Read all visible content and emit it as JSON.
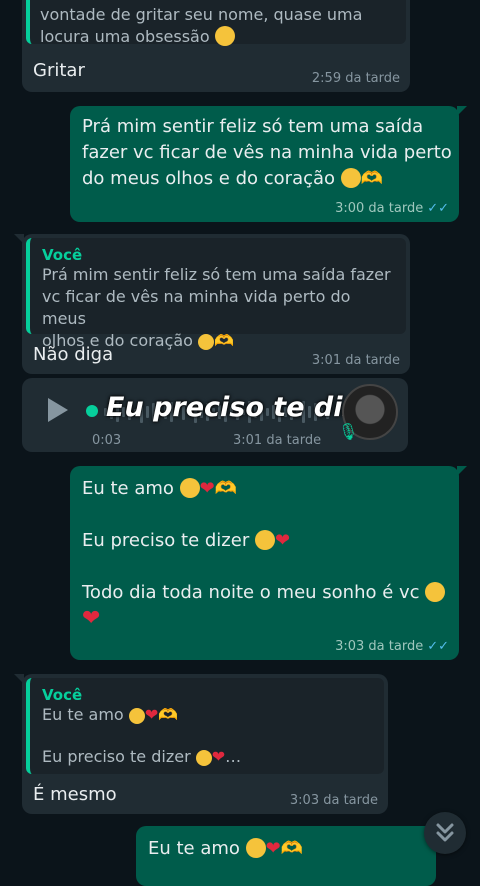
{
  "messages": {
    "m1": {
      "quote_text": "vontade de gritar seu nome, quase uma locura uma obsessão",
      "text": "Gritar",
      "time": "2:59 da tarde"
    },
    "m2": {
      "line1": "Prá mim sentir feliz só tem uma saída",
      "line2": "fazer vc ficar de vês na minha vida perto",
      "line3": "do meus olhos e do coração",
      "time": "3:00 da tarde"
    },
    "m3": {
      "quote_author": "Você",
      "quote_line1": "Prá mim sentir feliz só tem uma saída fazer",
      "quote_line2": "vc ficar de vês na minha vida perto do meus",
      "quote_line3": "olhos e do coração",
      "text": "Não diga",
      "time": "3:01 da tarde"
    },
    "m4": {
      "duration": "0:03",
      "time": "3:01 da tarde",
      "overlay": "Eu preciso te dizer"
    },
    "m5": {
      "line1": "Eu te amo",
      "line2": "Eu preciso te dizer",
      "line3": "Todo dia toda noite o meu sonho é vc",
      "time": "3:03 da tarde"
    },
    "m6": {
      "quote_author": "Você",
      "quote_line1": "Eu te amo",
      "quote_line2": "Eu preciso te dizer",
      "text": "É mesmo",
      "time": "3:03 da tarde"
    },
    "m7": {
      "text": "Eu te amo"
    }
  },
  "colors": {
    "incoming": "#202c33",
    "outgoing": "#005c4b",
    "accent": "#06cf9c",
    "read_ticks": "#53bdeb"
  },
  "icons": {
    "play": "play-icon",
    "mic": "mic-icon",
    "scroll_down": "chevron-double-down-icon"
  }
}
